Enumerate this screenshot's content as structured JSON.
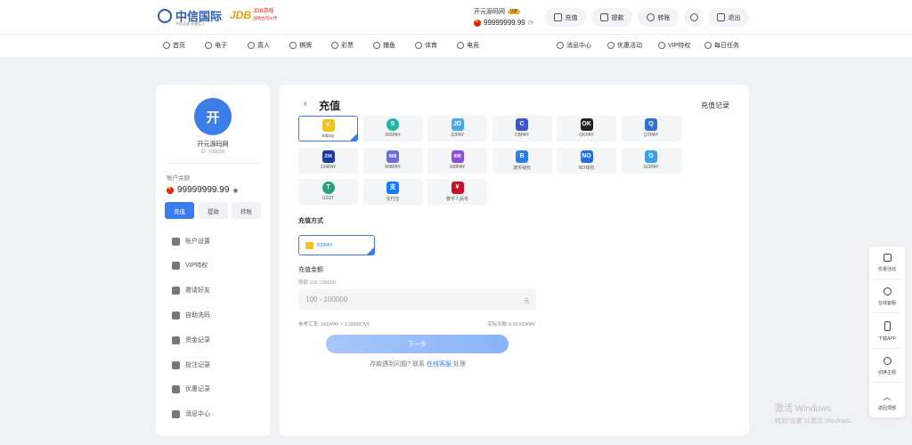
{
  "brand": {
    "name": "中信国际",
    "tagline": "中信品质 信誉至上",
    "partner_mark": "JDB",
    "partner_name": "JDB游戏",
    "partner_tagline": "战略合作伙伴"
  },
  "header": {
    "username": "开元源码网",
    "vip_badge": "VIP",
    "balance": "99999999.99",
    "buttons": {
      "deposit": "充值",
      "withdraw": "提款",
      "transfer": "转账",
      "logout": "退出"
    }
  },
  "nav": {
    "left": [
      "首页",
      "电子",
      "真人",
      "棋牌",
      "彩票",
      "捕鱼",
      "体育",
      "电竞"
    ],
    "right": [
      "消息中心",
      "优惠活动",
      "VIP特权",
      "每日任务"
    ]
  },
  "profile": {
    "avatar_char": "开",
    "name": "开元源码网",
    "id": "ID: 100056",
    "balance_label": "账户余额",
    "balance": "99999999.99",
    "actions": [
      "充值",
      "提款",
      "转账"
    ],
    "menu": [
      "账户设置",
      "VIP特权",
      "邀请好友",
      "自助洗码",
      "资金记录",
      "投注记录",
      "优惠记录",
      "消息中心"
    ]
  },
  "deposit": {
    "back": "‹",
    "title": "充值",
    "record_link": "充值记录",
    "channels": [
      {
        "name": "kdpay",
        "icon": "kdpay-icon",
        "color": "#f5c017",
        "mark": "K",
        "selected": true
      },
      {
        "name": "365PAY",
        "icon": "365pay-icon",
        "color": "#1bb8a6",
        "mark": "S",
        "selected": false
      },
      {
        "name": "JDPAY",
        "icon": "jdpay-icon",
        "color": "#4aa7e8",
        "mark": "JD",
        "selected": false
      },
      {
        "name": "CBPAY",
        "icon": "cbpay-icon",
        "color": "#3a55d6",
        "mark": "C",
        "selected": false
      },
      {
        "name": "OKPAY",
        "icon": "okpay-icon",
        "color": "#222222",
        "mark": "OK",
        "selected": false
      },
      {
        "name": "QTPAY",
        "icon": "qtpay-icon",
        "color": "#2f6fd6",
        "mark": "Q",
        "selected": false
      },
      {
        "name": "234PAY",
        "icon": "234pay-icon",
        "color": "#1a3aa5",
        "mark": "234",
        "selected": false
      },
      {
        "name": "808PAY",
        "icon": "808pay-icon",
        "color": "#6d6de0",
        "mark": "808",
        "selected": false
      },
      {
        "name": "998PAY",
        "icon": "998pay-icon",
        "color": "#8a4de0",
        "mark": "998",
        "selected": false
      },
      {
        "name": "波币钱包",
        "icon": "bobi-wallet-icon",
        "color": "#2a7ff0",
        "mark": "B",
        "selected": false
      },
      {
        "name": "NO钱包",
        "icon": "no-wallet-icon",
        "color": "#1f6fe8",
        "mark": "NO",
        "selected": false
      },
      {
        "name": "GOPAY",
        "icon": "gopay-icon",
        "color": "#3aa0e8",
        "mark": "G",
        "selected": false
      },
      {
        "name": "USDT",
        "icon": "usdt-icon",
        "color": "#26a17b",
        "mark": "T",
        "selected": false
      },
      {
        "name": "支付宝",
        "icon": "alipay-icon",
        "color": "#1677ff",
        "mark": "支",
        "selected": false
      },
      {
        "name": "数字人民币",
        "icon": "ecny-icon",
        "color": "#c8102e",
        "mark": "¥",
        "selected": false
      }
    ],
    "method_label": "充值方式",
    "method_selected": "KDPAY",
    "amount_label": "充值金额",
    "amount_limit": "限额 100-100000",
    "amount_placeholder": "100 - 100000",
    "amount_unit": "元",
    "rate_ref": "参考汇率: 1KDPAY ≈ 1.0000CNY",
    "rate_real": "实际到账 0.00 KDPAY",
    "next_button": "下一步",
    "help_text": "存款遇到问题? 联系",
    "help_link": "在线客服",
    "help_suffix": "处理"
  },
  "float_bar": [
    "优惠活动",
    "在线客服",
    "下载APP",
    "切换主题",
    "返回顶部"
  ],
  "watermark": {
    "line1": "激活 Windows",
    "line2": "转到\"设置\"以激活 Windows。"
  }
}
